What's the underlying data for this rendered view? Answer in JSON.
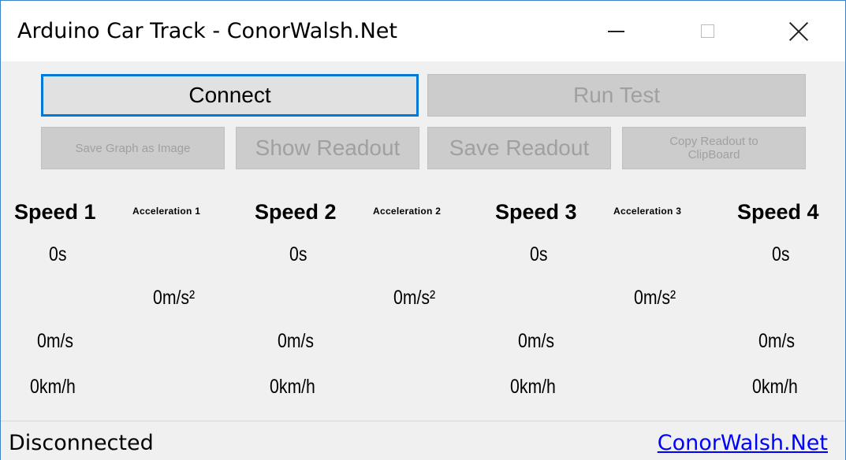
{
  "window": {
    "title": "Arduino Car Track - ConorWalsh.Net",
    "controls": {
      "minimize_icon": "minimize-icon",
      "maximize_icon": "maximize-icon",
      "close_icon": "close-icon"
    }
  },
  "buttons": {
    "connect": "Connect",
    "run_test": "Run Test",
    "save_graph": "Save Graph as Image",
    "show_readout": "Show Readout",
    "save_readout": "Save Readout",
    "copy_readout": "Copy Readout to ClipBoard"
  },
  "headers": {
    "speed_1": "Speed 1",
    "acceleration_1": "Acceleration 1",
    "speed_2": "Speed 2",
    "acceleration_2": "Acceleration 2",
    "speed_3": "Speed 3",
    "acceleration_3": "Acceleration 3",
    "speed_4": "Speed 4"
  },
  "readings": {
    "speed_1": {
      "time": "0s",
      "ms": "0m/s",
      "kmh": "0km/h"
    },
    "speed_2": {
      "time": "0s",
      "ms": "0m/s",
      "kmh": "0km/h"
    },
    "speed_3": {
      "time": "0s",
      "ms": "0m/s",
      "kmh": "0km/h"
    },
    "speed_4": {
      "time": "0s",
      "ms": "0m/s",
      "kmh": "0km/h"
    },
    "acceleration_1": "0m/s²",
    "acceleration_2": "0m/s²",
    "acceleration_3": "0m/s²"
  },
  "status": {
    "connection": "Disconnected",
    "link": "ConorWalsh.Net"
  },
  "colors": {
    "focus": "#0078d7",
    "window_bg": "#f0f0f0",
    "link": "#0000ff",
    "disabled_text": "#a0a0a0"
  }
}
